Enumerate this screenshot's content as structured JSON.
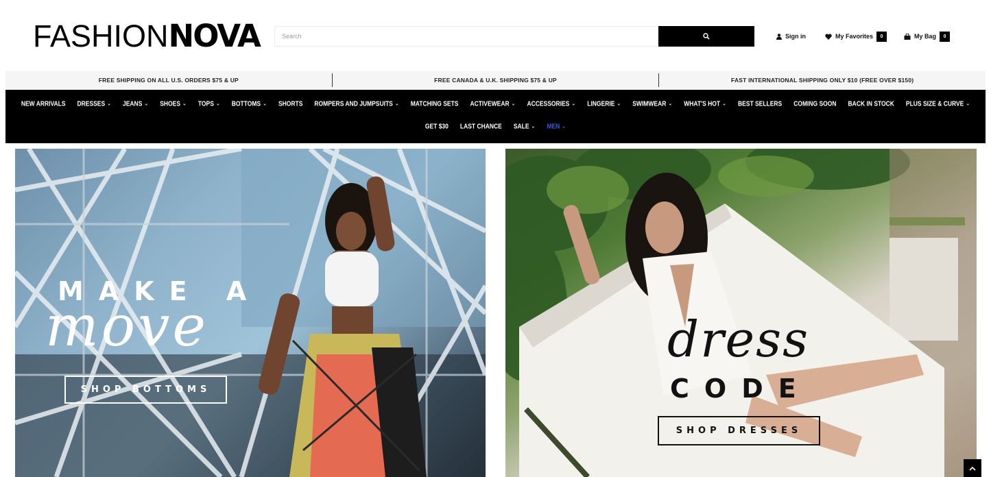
{
  "header": {
    "logo_thin": "FASHION",
    "logo_bold": "NOVA",
    "search_placeholder": "Search",
    "sign_in": "Sign in",
    "favorites_label": "My Favorites",
    "favorites_count": "0",
    "bag_label": "My Bag",
    "bag_count": "0"
  },
  "promo": [
    "FREE SHIPPING ON ALL U.S. ORDERS $75 & UP",
    "FREE CANADA & U.K. SHIPPING $75 & UP",
    "FAST INTERNATIONAL SHIPPING ONLY $10 (FREE OVER $150)"
  ],
  "nav": {
    "row1": [
      {
        "label": "NEW ARRIVALS",
        "dropdown": false
      },
      {
        "label": "DRESSES",
        "dropdown": true
      },
      {
        "label": "JEANS",
        "dropdown": true
      },
      {
        "label": "SHOES",
        "dropdown": true
      },
      {
        "label": "TOPS",
        "dropdown": true
      },
      {
        "label": "BOTTOMS",
        "dropdown": true
      },
      {
        "label": "SHORTS",
        "dropdown": false
      },
      {
        "label": "ROMPERS AND JUMPSUITS",
        "dropdown": true
      },
      {
        "label": "MATCHING SETS",
        "dropdown": false
      },
      {
        "label": "ACTIVEWEAR",
        "dropdown": true
      },
      {
        "label": "ACCESSORIES",
        "dropdown": true
      },
      {
        "label": "LINGERIE",
        "dropdown": true
      },
      {
        "label": "SWIMWEAR",
        "dropdown": true
      },
      {
        "label": "WHAT'S HOT",
        "dropdown": true
      },
      {
        "label": "BEST SELLERS",
        "dropdown": false
      },
      {
        "label": "COMING SOON",
        "dropdown": false
      },
      {
        "label": "BACK IN STOCK",
        "dropdown": false
      },
      {
        "label": "PLUS SIZE & CURVE",
        "dropdown": true
      }
    ],
    "row2": [
      {
        "label": "GET $30",
        "dropdown": false
      },
      {
        "label": "LAST CHANCE",
        "dropdown": false
      },
      {
        "label": "SALE",
        "dropdown": true
      },
      {
        "label": "MEN",
        "dropdown": true,
        "accent": true
      }
    ],
    "chevron": "⌄"
  },
  "banners": {
    "left": {
      "caps": "MAKE A",
      "script": "move",
      "button": "SHOP BOTTOMS"
    },
    "right": {
      "script": "dress",
      "caps": "CODE",
      "button": "SHOP DRESSES"
    }
  },
  "colors": {
    "black": "#000000",
    "promo_bg": "#f5f5f5",
    "men_accent": "#3a5bd9",
    "white": "#ffffff"
  },
  "icons": {
    "search": "search-icon",
    "user": "user-icon",
    "heart": "heart-icon",
    "bag": "bag-icon",
    "scroll_top": "chevron-up-icon"
  }
}
